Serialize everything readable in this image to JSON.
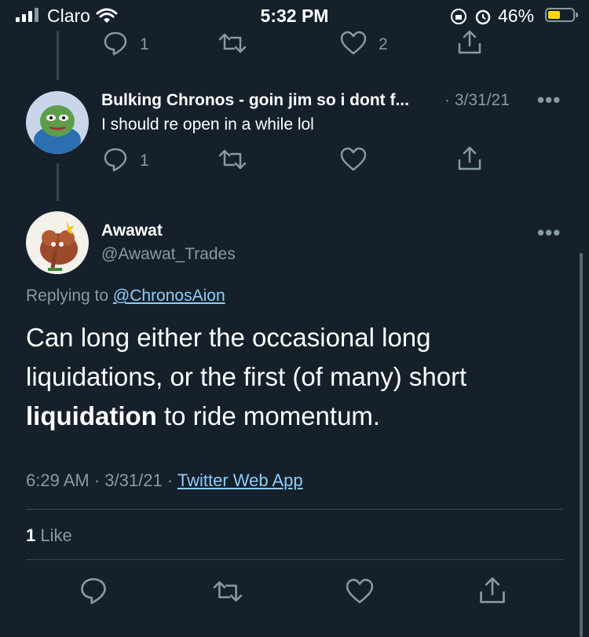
{
  "status_bar": {
    "carrier": "Claro",
    "time": "5:32 PM",
    "battery": "46%"
  },
  "top_actions": {
    "reply_count": "1",
    "like_count": "2"
  },
  "reply_tweet": {
    "author": "Bulking Chronos - goin jim so i dont f...",
    "date": "· 3/31/21",
    "text": "I should re open in a while lol",
    "reply_count": "1"
  },
  "main_tweet": {
    "name": "Awawat",
    "handle": "@Awawat_Trades",
    "replying_prefix": "Replying to",
    "replying_to": "@ChronosAion",
    "text_part1": "Can long either the occasional long liquidations, or the first (of many) short",
    "text_bold": "liquidation",
    "text_part2": " to ride momentum.",
    "time": "6:29 AM",
    "date": "3/31/21",
    "sep": "·",
    "source": "Twitter Web App",
    "likes_count": "1",
    "likes_label": "Like"
  },
  "colors": {
    "background": "#15202b",
    "muted": "#8899a6",
    "link": "#8ecdf8",
    "divider": "#38444d"
  },
  "icons": [
    "reply-icon",
    "retweet-icon",
    "like-icon",
    "share-icon",
    "more-icon",
    "wifi-icon",
    "signal-icon",
    "battery-icon"
  ]
}
